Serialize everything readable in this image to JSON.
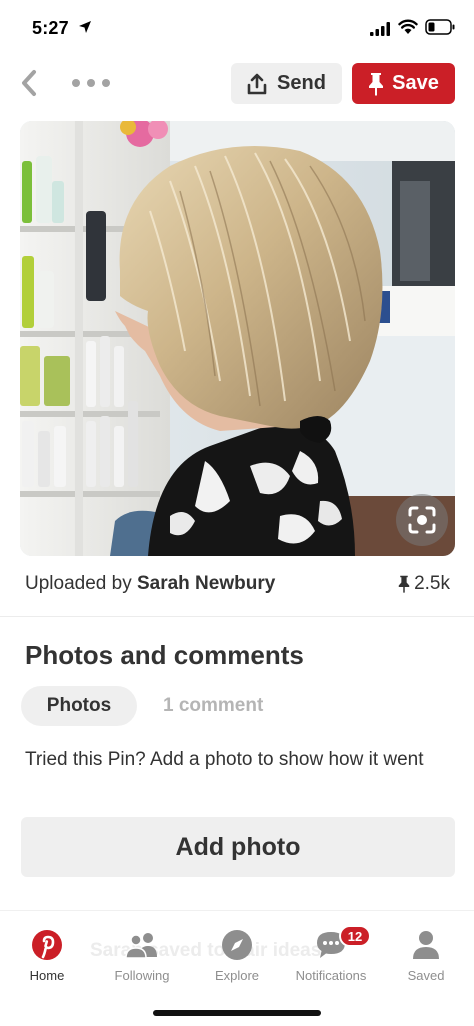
{
  "status_bar": {
    "time": "5:27"
  },
  "toolbar": {
    "send_label": "Send",
    "save_label": "Save"
  },
  "pin": {
    "uploaded_prefix": "Uploaded by ",
    "uploader": "Sarah Newbury",
    "save_count": "2.5k"
  },
  "photos_section": {
    "title": "Photos and comments",
    "tabs": [
      {
        "label": "Photos"
      },
      {
        "label": "1 comment"
      }
    ],
    "prompt": "Tried this Pin? Add a photo to show how it went",
    "add_photo_label": "Add photo"
  },
  "background_text": "Sarah saved to Hair ideas",
  "bottom_nav": {
    "items": [
      {
        "label": "Home"
      },
      {
        "label": "Following"
      },
      {
        "label": "Explore"
      },
      {
        "label": "Notifications"
      },
      {
        "label": "Saved"
      }
    ],
    "notifications_badge": "12"
  },
  "colors": {
    "brand_red": "#cb1f27",
    "button_gray": "#efefef",
    "text": "#333333",
    "muted": "#8e8e8e"
  }
}
